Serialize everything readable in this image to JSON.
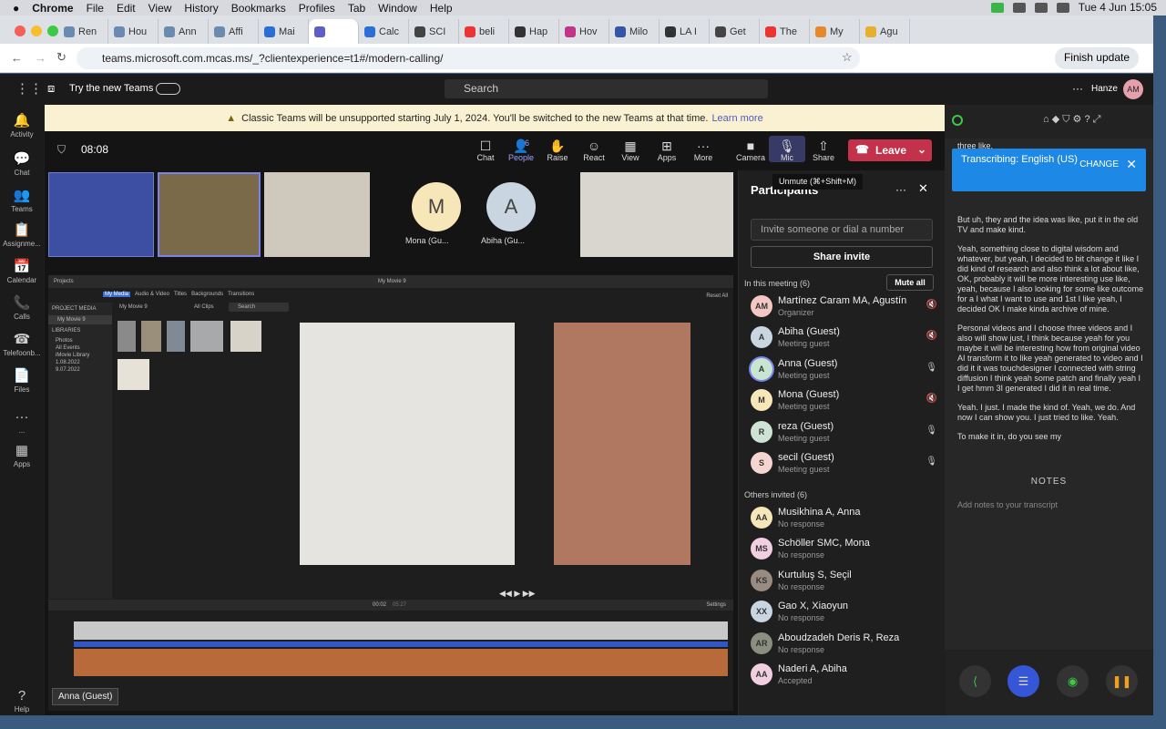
{
  "menubar": {
    "app": "Chrome",
    "items": [
      "File",
      "Edit",
      "View",
      "History",
      "Bookmarks",
      "Profiles",
      "Tab",
      "Window",
      "Help"
    ],
    "clock": "Tue 4 Jun  15:05"
  },
  "tabs": [
    {
      "label": "Ren",
      "c": "#6a8ab0"
    },
    {
      "label": "Hou",
      "c": "#6a8ab0"
    },
    {
      "label": "Ann",
      "c": "#6a8ab0"
    },
    {
      "label": "Affi",
      "c": "#6a8ab0"
    },
    {
      "label": "Mai",
      "c": "#2b6fd6"
    },
    {
      "label": "",
      "c": "#5b5fc7",
      "active": true
    },
    {
      "label": "Calc",
      "c": "#2b6fd6"
    },
    {
      "label": "SCI",
      "c": "#444"
    },
    {
      "label": "beli",
      "c": "#e33"
    },
    {
      "label": "Hap",
      "c": "#333"
    },
    {
      "label": "Hov",
      "c": "#c2338a"
    },
    {
      "label": "Milo",
      "c": "#3355aa"
    },
    {
      "label": "LA I",
      "c": "#333"
    },
    {
      "label": "Get",
      "c": "#444"
    },
    {
      "label": "The",
      "c": "#e33"
    },
    {
      "label": "My",
      "c": "#e58a2c"
    },
    {
      "label": "Agu",
      "c": "#e5b02c"
    }
  ],
  "address": {
    "url": "teams.microsoft.com.mcas.ms/_?clientexperience=t1#/modern-calling/",
    "finish": "Finish update"
  },
  "teams": {
    "try_new": "Try the new Teams",
    "search": "Search",
    "org": "Hanze",
    "me": "AM"
  },
  "rail": [
    "Activity",
    "Chat",
    "Teams",
    "Assignme...",
    "Calendar",
    "Calls",
    "Telefoonb...",
    "Files",
    "...",
    "Apps",
    "Help"
  ],
  "banner": {
    "text": "Classic Teams will be unsupported starting July 1, 2024. You'll be switched to the new Teams at that time.",
    "link": "Learn more"
  },
  "call": {
    "timer": "08:08",
    "people_count": "6",
    "leave": "Leave",
    "unmute_tip": "Unmute (⌘+Shift+M)"
  },
  "toolbar": [
    {
      "icon": "chat",
      "label": "Chat"
    },
    {
      "icon": "people",
      "label": "People"
    },
    {
      "icon": "raise",
      "label": "Raise"
    },
    {
      "icon": "react",
      "label": "React"
    },
    {
      "icon": "view",
      "label": "View"
    },
    {
      "icon": "apps",
      "label": "Apps"
    },
    {
      "icon": "more",
      "label": "More"
    },
    {
      "icon": "camera",
      "label": "Camera"
    },
    {
      "icon": "mic",
      "label": "Mic"
    },
    {
      "icon": "share",
      "label": "Share"
    }
  ],
  "tiles": [
    {
      "initial": "M",
      "name": "Mona (Gu..."
    },
    {
      "initial": "A",
      "name": "Abiha (Gu..."
    }
  ],
  "imovie": {
    "back": "Projects",
    "title": "My Movie 9",
    "tabs": [
      "My Media",
      "Audio & Video",
      "Titles",
      "Backgrounds",
      "Transitions"
    ],
    "reset": "Reset All",
    "project_media": "PROJECT MEDIA",
    "project": "My Movie 9",
    "libraries": "LIBRARIES",
    "lib_items": [
      "Photos",
      "All Events",
      "iMovie Library",
      "1.08.2022",
      "9.07.2022"
    ],
    "browser_title": "My Movie 9",
    "all_clips": "All Clips",
    "search": "Search",
    "time": "00:02",
    "total": "05:27",
    "settings": "Settings"
  },
  "presenter_tooltip": "Anna (Guest)",
  "participants": {
    "title": "Participants",
    "invite_placeholder": "Invite someone or dial a number",
    "share_invite": "Share invite",
    "in_meeting": "In this meeting (6)",
    "mute_all": "Mute all",
    "others": "Others invited (6)",
    "meeting": [
      {
        "av": "AM",
        "name": "Martínez Caram MA, Agustín",
        "role": "Organizer",
        "c": "#f3c7c3",
        "mic": "muted"
      },
      {
        "av": "A",
        "name": "Abiha (Guest)",
        "role": "Meeting guest",
        "c": "#c9d6e2",
        "mic": "muted"
      },
      {
        "av": "A",
        "name": "Anna (Guest)",
        "role": "Meeting guest",
        "c": "#c8e6cf",
        "mic": "on"
      },
      {
        "av": "M",
        "name": "Mona (Guest)",
        "role": "Meeting guest",
        "c": "#f7e6b8",
        "mic": "muted"
      },
      {
        "av": "R",
        "name": "reza (Guest)",
        "role": "Meeting guest",
        "c": "#cfe3d4",
        "mic": "on"
      },
      {
        "av": "S",
        "name": "secil (Guest)",
        "role": "Meeting guest",
        "c": "#f5d5cf",
        "mic": "on"
      }
    ],
    "invited": [
      {
        "av": "AA",
        "name": "Musikhina A, Anna",
        "role": "No response",
        "c": "#f7e6b8"
      },
      {
        "av": "MS",
        "name": "Schöller SMC, Mona",
        "role": "No response",
        "c": "#f0cfe0"
      },
      {
        "av": "KS",
        "name": "Kurtuluş S, Seçil",
        "role": "No response",
        "c": "#9a8b80"
      },
      {
        "av": "XX",
        "name": "Gao X, Xiaoyun",
        "role": "No response",
        "c": "#c9d6e2"
      },
      {
        "av": "AR",
        "name": "Aboudzadeh Deris R, Reza",
        "role": "No response",
        "c": "#8a8f80"
      },
      {
        "av": "AA",
        "name": "Naderi A, Abiha",
        "role": "Accepted",
        "c": "#f0cfe0"
      }
    ]
  },
  "transcript": {
    "box": "Transcribing: English (US)",
    "change": "CHANGE",
    "paragraphs": [
      "three like.",
      "But uh, they and the idea was like, put it in the old TV and make kind.",
      "Yeah, something close to digital wisdom and whatever, but yeah, I decided to bit change it like I did kind of research and also think a lot about like, OK, probably it will be more interesting use like, yeah, because I also looking for some like outcome for a I what I want to use and 1st I like yeah, I decided OK I make kinda archive of mine.",
      "Personal videos and I choose three videos and I also will show just, I think because yeah for you maybe it will be interesting how from original video AI transform it to like yeah generated to video and I did it it was touchdesigner I connected with string diffusion I think yeah some patch and finally yeah I I get hmm 3I generated I did it in real time.",
      "Yeah. I just. I made the kind of. Yeah, we do. And now I can show you. I just tried to like. Yeah.",
      "To make it in, do you see my"
    ],
    "notes": "NOTES",
    "add_notes": "Add notes to your transcript"
  }
}
